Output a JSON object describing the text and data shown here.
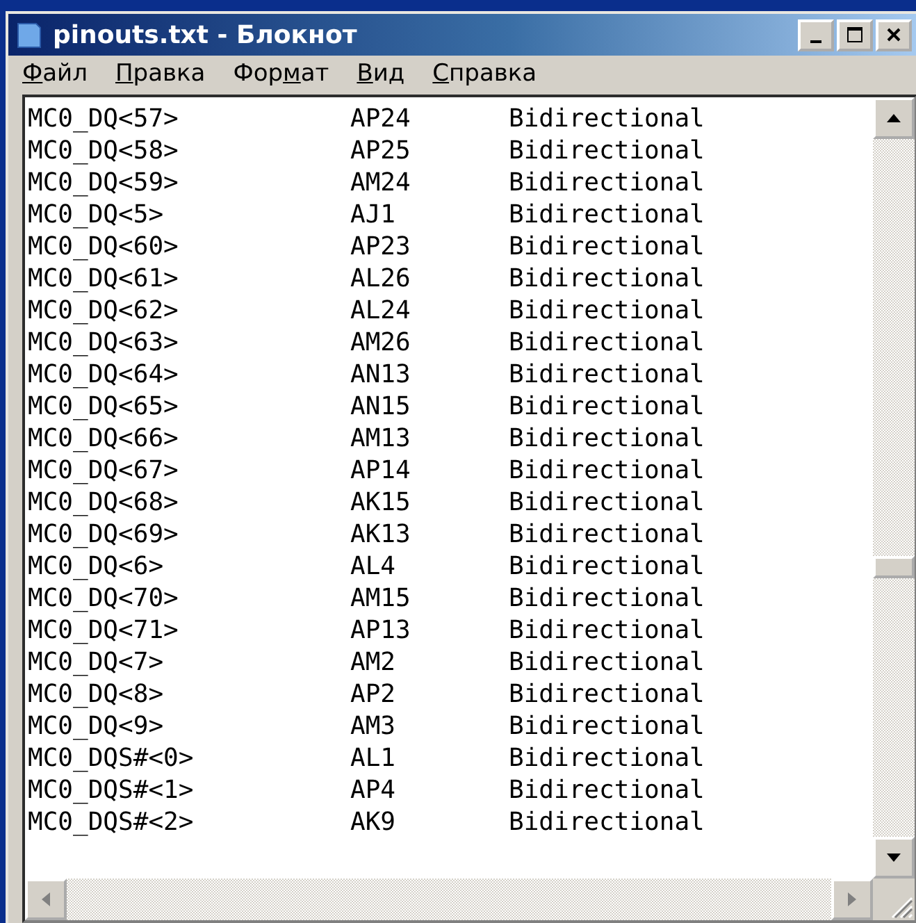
{
  "window": {
    "title": "pinouts.txt - Блокнот"
  },
  "menu": [
    {
      "key": "Ф",
      "rest": "айл"
    },
    {
      "key": "П",
      "rest": "равка"
    },
    {
      "prefix": "Фор",
      "key": "м",
      "rest": "ат"
    },
    {
      "key": "В",
      "rest": "ид"
    },
    {
      "key": "С",
      "rest": "правка"
    }
  ],
  "rows": [
    [
      "MC0_DQ<57>",
      "AP24",
      "Bidirectional"
    ],
    [
      "MC0_DQ<58>",
      "AP25",
      "Bidirectional"
    ],
    [
      "MC0_DQ<59>",
      "AM24",
      "Bidirectional"
    ],
    [
      "MC0_DQ<5>",
      "AJ1",
      "Bidirectional"
    ],
    [
      "MC0_DQ<60>",
      "AP23",
      "Bidirectional"
    ],
    [
      "MC0_DQ<61>",
      "AL26",
      "Bidirectional"
    ],
    [
      "MC0_DQ<62>",
      "AL24",
      "Bidirectional"
    ],
    [
      "MC0_DQ<63>",
      "AM26",
      "Bidirectional"
    ],
    [
      "MC0_DQ<64>",
      "AN13",
      "Bidirectional"
    ],
    [
      "MC0_DQ<65>",
      "AN15",
      "Bidirectional"
    ],
    [
      "MC0_DQ<66>",
      "AM13",
      "Bidirectional"
    ],
    [
      "MC0_DQ<67>",
      "AP14",
      "Bidirectional"
    ],
    [
      "MC0_DQ<68>",
      "AK15",
      "Bidirectional"
    ],
    [
      "MC0_DQ<69>",
      "AK13",
      "Bidirectional"
    ],
    [
      "MC0_DQ<6>",
      "AL4",
      "Bidirectional"
    ],
    [
      "MC0_DQ<70>",
      "AM15",
      "Bidirectional"
    ],
    [
      "MC0_DQ<71>",
      "AP13",
      "Bidirectional"
    ],
    [
      "MC0_DQ<7>",
      "AM2",
      "Bidirectional"
    ],
    [
      "MC0_DQ<8>",
      "AP2",
      "Bidirectional"
    ],
    [
      "MC0_DQ<9>",
      "AM3",
      "Bidirectional"
    ],
    [
      "MC0_DQS#<0>",
      "AL1",
      "Bidirectional"
    ],
    [
      "MC0_DQS#<1>",
      "AP4",
      "Bidirectional"
    ],
    [
      "MC0_DQS#<2>",
      "AK9",
      "Bidirectional"
    ]
  ]
}
